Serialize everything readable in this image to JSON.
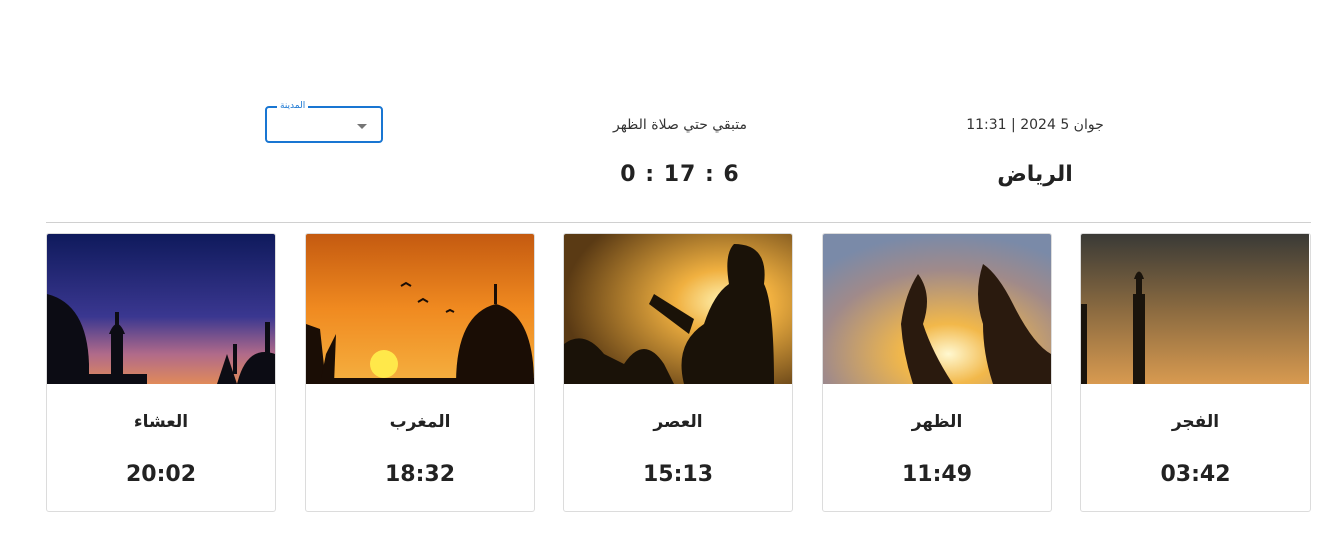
{
  "header": {
    "date_text": "جوان 5 2024 | 11:31",
    "city": "الرياض",
    "remaining_label": "متبقي حتي صلاة الظهر",
    "countdown": "0 : 17 : 6"
  },
  "city_select": {
    "label": "المدينة",
    "value": ""
  },
  "prayers": [
    {
      "name": "الفجر",
      "time": "03:42"
    },
    {
      "name": "الظهر",
      "time": "11:49"
    },
    {
      "name": "العصر",
      "time": "15:13"
    },
    {
      "name": "المغرب",
      "time": "18:32"
    },
    {
      "name": "العشاء",
      "time": "20:02"
    }
  ],
  "colors": {
    "select_border": "#1976d2",
    "divider": "#d0d0d0",
    "text": "#222222"
  }
}
